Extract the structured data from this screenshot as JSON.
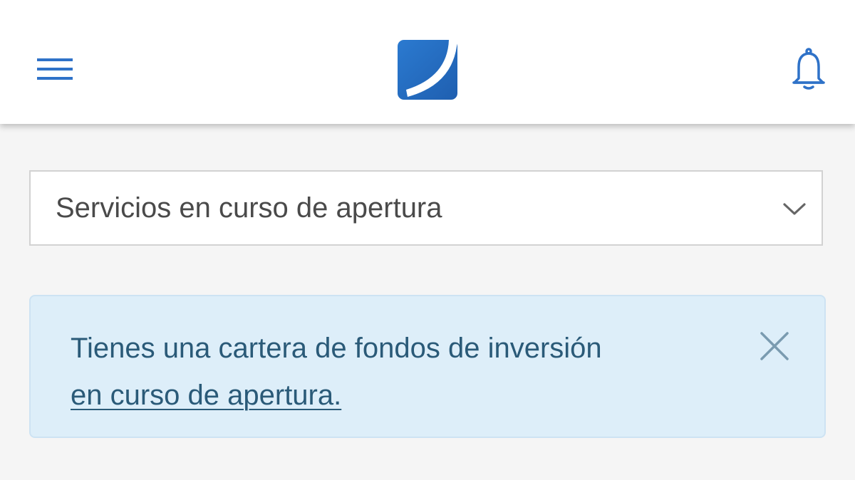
{
  "header": {
    "menu_icon": "hamburger-menu-icon",
    "logo_icon": "bank-logo",
    "notifications_icon": "bell-icon"
  },
  "services_select": {
    "selected_value": "Servicios en curso de apertura",
    "icon": "chevron-down-icon"
  },
  "alert": {
    "message": "Tienes una cartera de fondos de inversión",
    "link_text": "en curso de apertura.",
    "close_icon": "close-icon"
  },
  "colors": {
    "brand": "#2f72c8",
    "background": "#f5f5f5",
    "alert_background": "#ddeef9",
    "alert_text": "#2a5a78"
  }
}
